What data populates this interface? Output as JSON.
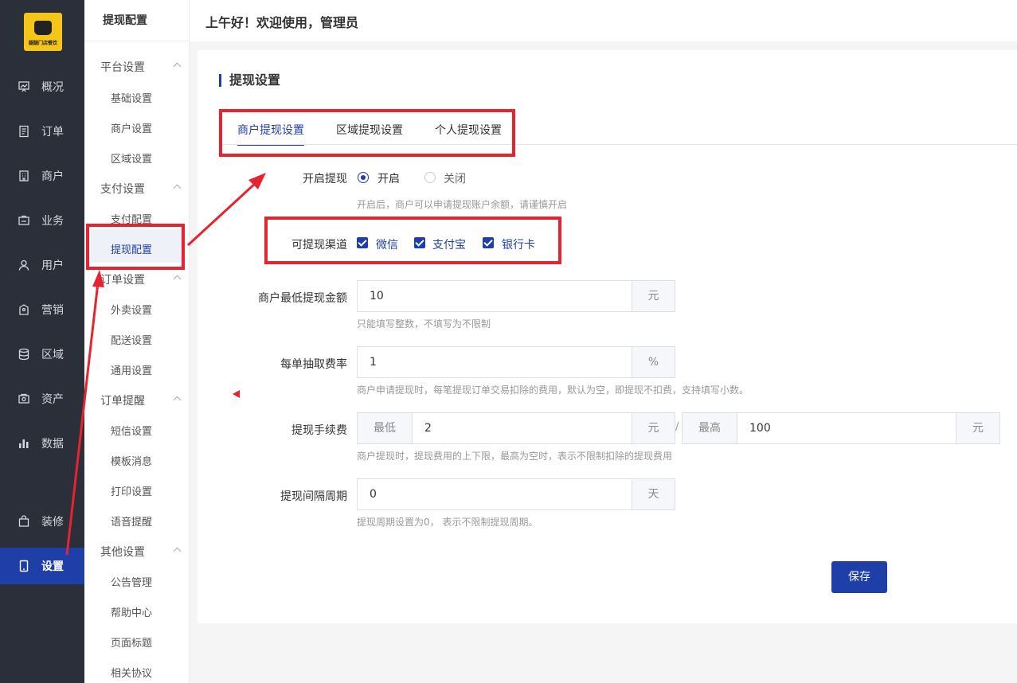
{
  "logo": {
    "text": "腿腿门店餐饮"
  },
  "nav": {
    "items": [
      {
        "label": "概况",
        "icon": "chart-board-icon"
      },
      {
        "label": "订单",
        "icon": "order-list-icon"
      },
      {
        "label": "商户",
        "icon": "building-icon"
      },
      {
        "label": "业务",
        "icon": "briefcase-icon"
      },
      {
        "label": "用户",
        "icon": "user-icon"
      },
      {
        "label": "营销",
        "icon": "tag-icon"
      },
      {
        "label": "区域",
        "icon": "database-icon"
      },
      {
        "label": "资产",
        "icon": "wallet-icon"
      },
      {
        "label": "数据",
        "icon": "bar-chart-icon"
      }
    ],
    "decorate": "装修",
    "settings": "设置"
  },
  "submenu": {
    "title": "提现配置",
    "groups": [
      {
        "label": "平台设置",
        "items": [
          "基础设置",
          "商户设置",
          "区域设置"
        ]
      },
      {
        "label": "支付设置",
        "items": [
          "支付配置",
          "提现配置"
        ]
      },
      {
        "label": "订单设置",
        "items": [
          "外卖设置",
          "配送设置",
          "通用设置"
        ]
      },
      {
        "label": "订单提醒",
        "items": [
          "短信设置",
          "模板消息",
          "打印设置",
          "语音提醒"
        ]
      },
      {
        "label": "其他设置",
        "items": [
          "公告管理",
          "帮助中心",
          "页面标题",
          "相关协议"
        ]
      }
    ],
    "active": "提现配置"
  },
  "header": {
    "greeting": "上午好！欢迎使用，管理员"
  },
  "card": {
    "title": "提现设置",
    "tabs": [
      "商户提现设置",
      "区域提现设置",
      "个人提现设置"
    ],
    "active_tab": "商户提现设置"
  },
  "form": {
    "enable": {
      "label": "开启提现",
      "options": [
        "开启",
        "关闭"
      ],
      "selected": "开启",
      "hint": "开启后，商户可以申请提现账户余额，请谨慎开启"
    },
    "channels": {
      "label": "可提现渠道",
      "options": [
        "微信",
        "支付宝",
        "银行卡"
      ],
      "checked": [
        "微信",
        "支付宝",
        "银行卡"
      ]
    },
    "min_amount": {
      "label": "商户最低提现金额",
      "value": "10",
      "unit": "元",
      "hint": "只能填写整数，不填写为不限制"
    },
    "fee_rate": {
      "label": "每单抽取费率",
      "value": "1",
      "unit": "%",
      "hint": "商户申请提现时，每笔提现订单交易扣除的费用，默认为空，即提现不扣费，支持填写小数。"
    },
    "fee": {
      "label": "提现手续费",
      "min_label": "最低",
      "min_value": "2",
      "min_unit": "元",
      "sep": "/",
      "max_label": "最高",
      "max_value": "100",
      "max_unit": "元",
      "hint": "商户提现时，提现费用的上下限，最高为空时，表示不限制扣除的提现费用"
    },
    "interval": {
      "label": "提现间隔周期",
      "value": "0",
      "unit": "天",
      "hint": "提现周期设置为0， 表示不限制提现周期。"
    },
    "save": "保存"
  },
  "annotation_color": "#e8232f",
  "accent_color": "#1e3ea8"
}
